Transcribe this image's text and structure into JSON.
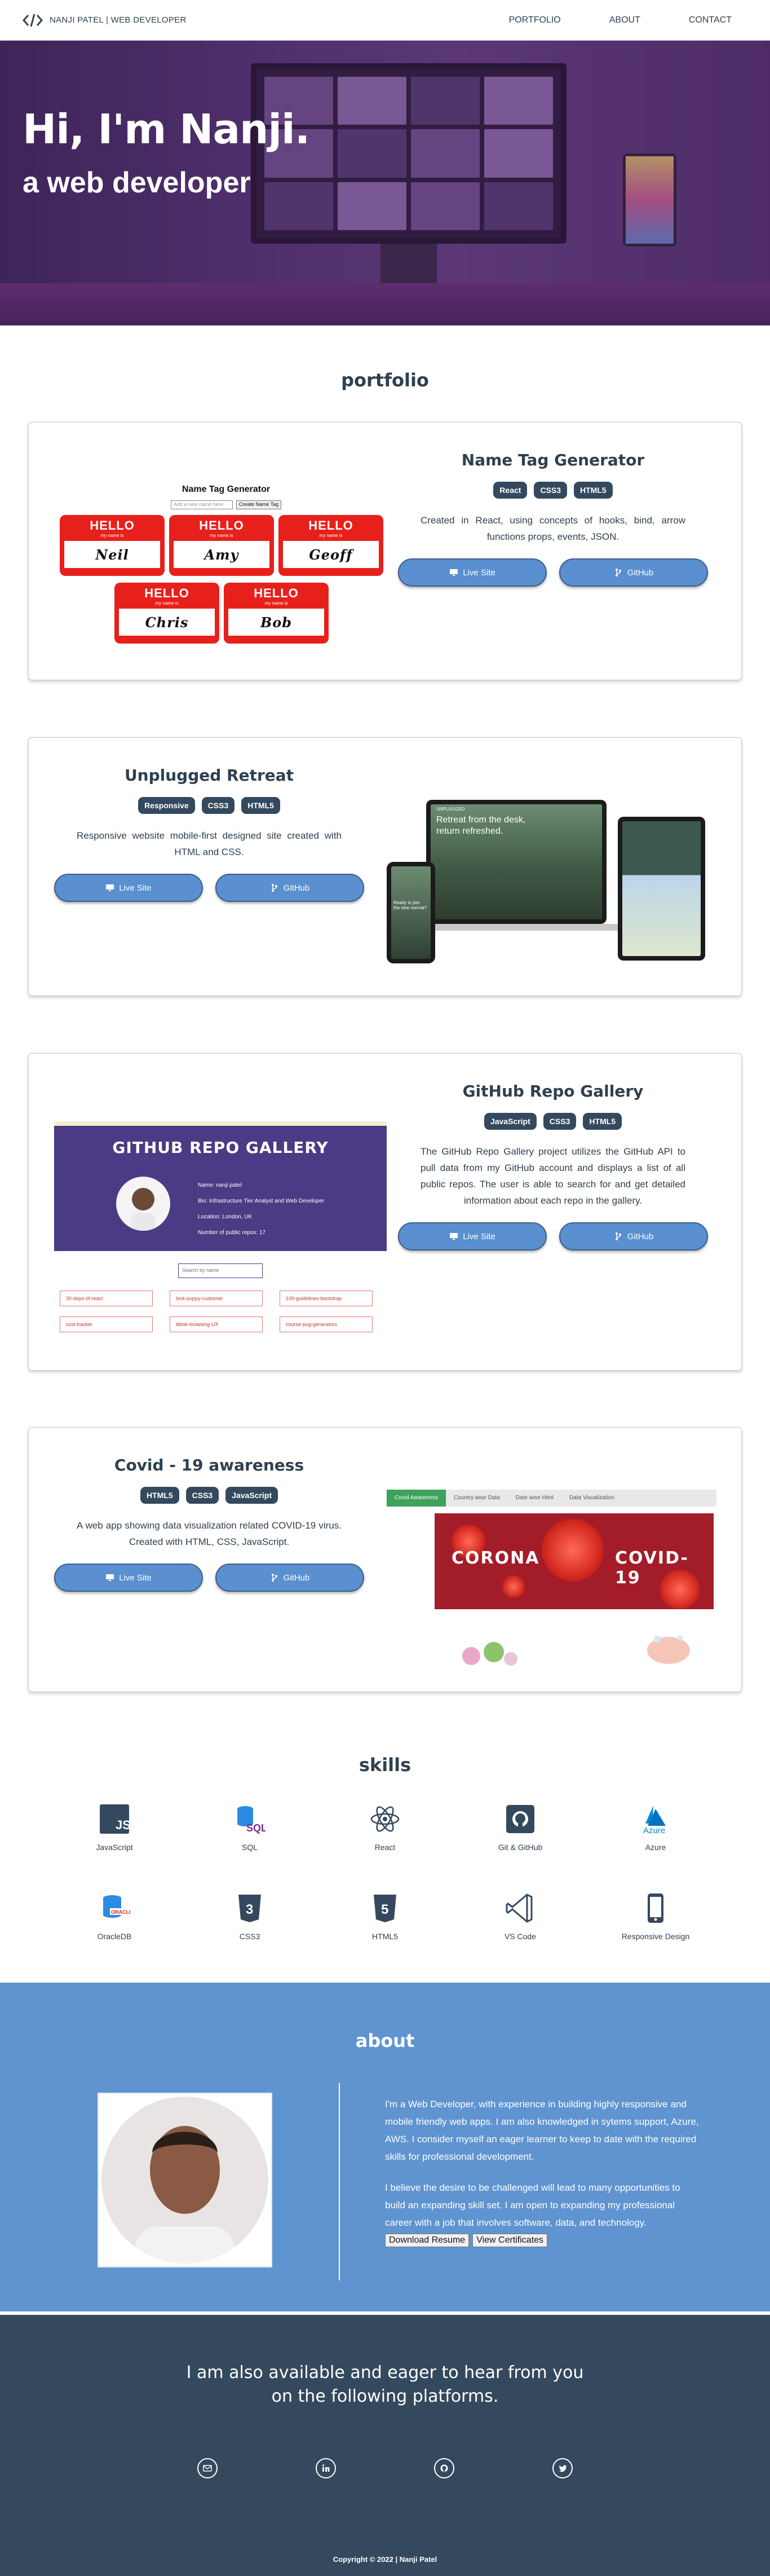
{
  "navbar": {
    "brand": "NANJI PATEL | WEB DEVELOPER",
    "links": [
      "PORTFOLIO",
      "ABOUT",
      "CONTACT"
    ]
  },
  "hero": {
    "title": "Hi, I'm Nanji.",
    "subtitle": "a web developer"
  },
  "portfolio": {
    "heading": "portfolio",
    "live_label": "Live Site",
    "github_label": "GitHub",
    "projects": [
      {
        "title": "Name Tag Generator",
        "badges": [
          "React",
          "CSS3",
          "HTML5"
        ],
        "description": "Created in React, using concepts of hooks, bind, arrow functions props, events, JSON."
      },
      {
        "title": "Unplugged Retreat",
        "badges": [
          "Responsive",
          "CSS3",
          "HTML5"
        ],
        "description": "Responsive website mobile-first designed site created with HTML and CSS."
      },
      {
        "title": "GitHub Repo Gallery",
        "badges": [
          "JavaScript",
          "CSS3",
          "HTML5"
        ],
        "description": "The GitHub Repo Gallery project utilizes the GitHub API to pull data from my GitHub account and displays a list of all public repos. The user is able to search for and get detailed information about each repo in the gallery."
      },
      {
        "title": "Covid - 19 awareness",
        "badges": [
          "HTML5",
          "CSS3",
          "JavaScript"
        ],
        "description": "A web app showing data visualization related COVID-19 virus. Created with HTML, CSS, JavaScript."
      }
    ],
    "nametag_preview": {
      "title": "Name Tag Generator",
      "input_placeholder": "Add a new name here",
      "button": "Create Name Tag",
      "hello": "HELLO",
      "sub": "my name is",
      "names": [
        "Neil",
        "Amy",
        "Geoff",
        "Chris",
        "Bob"
      ]
    },
    "unplugged_preview": {
      "headline": "Retreat from the desk, return refreshed.",
      "phone_text": "Ready to join the new normal?",
      "logo": "UNPLUGGED"
    },
    "gallery_preview": {
      "title": "GITHUB REPO GALLERY",
      "info": [
        "Name: nanji patel",
        "Bio: Infrastructure Tier Analyst and Web Developer",
        "Location: London, UK",
        "Number of public repos: 17"
      ],
      "search_placeholder": "Search by name",
      "repos": [
        "30-days-of-react",
        "lock-puppy-customer",
        "100-guidelines-bootstrap",
        "cost-tracker",
        "tiktok-browsing-UX",
        "course-pug-generators"
      ]
    },
    "covid_preview": {
      "tabs": [
        "Covid Awareness",
        "Country wise Data",
        "Date wise Html",
        "Data Visualization"
      ],
      "banner_left": "CORONA",
      "banner_right": "COVID-19"
    }
  },
  "skills": {
    "heading": "skills",
    "items": [
      {
        "label": "JavaScript",
        "icon": "javascript-icon",
        "color": "#34495e"
      },
      {
        "label": "SQL",
        "icon": "sql-icon",
        "color": "#7b2d8e"
      },
      {
        "label": "React",
        "icon": "react-icon",
        "color": "#34495e"
      },
      {
        "label": "Git & GitHub",
        "icon": "github-icon",
        "color": "#34495e"
      },
      {
        "label": "Azure",
        "icon": "azure-icon",
        "color": "#0089d6"
      },
      {
        "label": "OracleDB",
        "icon": "oracle-db-icon",
        "color": "#2b8be0"
      },
      {
        "label": "CSS3",
        "icon": "css3-icon",
        "color": "#34495e"
      },
      {
        "label": "HTML5",
        "icon": "html5-icon",
        "color": "#34495e"
      },
      {
        "label": "VS Code",
        "icon": "vscode-icon",
        "color": "#34495e"
      },
      {
        "label": "Responsive Design",
        "icon": "mobile-icon",
        "color": "#34495e"
      }
    ]
  },
  "about": {
    "heading": "about",
    "paragraph_1": "I'm a Web Developer, with experience in building highly responsive and mobile friendly web apps. I am also knowledged in sytems support, Azure, AWS. I consider myself an eager learner to keep to date with the required skills for professional development.",
    "paragraph_2": "I believe the desire to be challenged will lead to many opportunities to build an expanding skill set. I am open to expanding my professional career with a job that involves software, data, and technology.",
    "resume_button": "Download Resume",
    "certificates_button": "View Certificates"
  },
  "contact": {
    "title_line_1": "I am also available and eager to hear from you",
    "title_line_2": "on the following platforms.",
    "socials": [
      "email-icon",
      "linkedin-icon",
      "github-icon",
      "twitter-icon"
    ],
    "copyright": "Copyright © 2022 | Nanji Patel"
  },
  "colors": {
    "primary": "#34495e",
    "button": "#5a8fd0",
    "about_bg": "#5f94d1",
    "contact_bg": "#34495e"
  }
}
